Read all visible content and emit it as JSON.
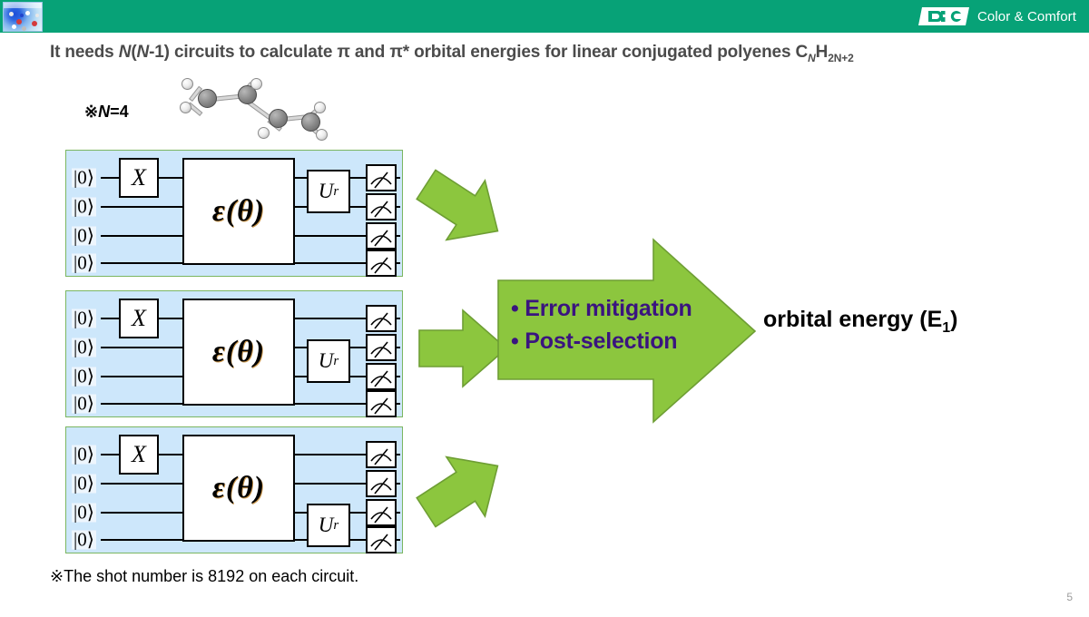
{
  "header": {
    "brand_text": "Color & Comfort",
    "logo_mark": "dic",
    "thumbnail_caption": "molecular-visualization",
    "background_color": "#07A277"
  },
  "title": {
    "prefix": "It needs ",
    "n_italic_1": "N",
    "paren_open": "(",
    "n_italic_2": "N",
    "paren_rest": "-1) circuits to calculate π and π*  orbital energies for linear conjugated polyenes C",
    "sub_1": "N",
    "mid": "H",
    "sub_2": "2N+2",
    "full_text": "It needs N(N-1) circuits to calculate π and π*  orbital energies for linear conjugated polyenes CNH2N+2"
  },
  "note": {
    "marker": "※",
    "label_italic": "N",
    "value": "=4",
    "molecule_name": "butadiene-ball-and-stick"
  },
  "circuits": [
    {
      "id": "circuit-1",
      "qubit_labels": [
        "|0⟩",
        "|0⟩",
        "|0⟩",
        "|0⟩"
      ],
      "x_gate": "X",
      "ansatz_gate": "ε(θ)",
      "rotation_gate": "U",
      "rotation_sub": "r",
      "rotation_span": "qubits 0-1",
      "measurements": 4
    },
    {
      "id": "circuit-2",
      "qubit_labels": [
        "|0⟩",
        "|0⟩",
        "|0⟩",
        "|0⟩"
      ],
      "x_gate": "X",
      "ansatz_gate": "ε(θ)",
      "rotation_gate": "U",
      "rotation_sub": "r",
      "rotation_span": "qubits 1-2",
      "measurements": 4
    },
    {
      "id": "circuit-3",
      "qubit_labels": [
        "|0⟩",
        "|0⟩",
        "|0⟩",
        "|0⟩"
      ],
      "x_gate": "X",
      "ansatz_gate": "ε(θ)",
      "rotation_gate": "U",
      "rotation_sub": "r",
      "rotation_span": "qubits 2-3",
      "measurements": 4
    }
  ],
  "process_arrow": {
    "bullets": [
      "• Error mitigation",
      "• Post-selection"
    ],
    "fill_color": "#8CC63E",
    "text_color": "#3A147F"
  },
  "result": {
    "label": "orbital energy (E",
    "subscript": "1",
    "suffix": ")",
    "full_text": "orbital energy (E1)"
  },
  "footer": {
    "footnote": "※The shot number is 8192 on each circuit.",
    "page_number": "5"
  }
}
